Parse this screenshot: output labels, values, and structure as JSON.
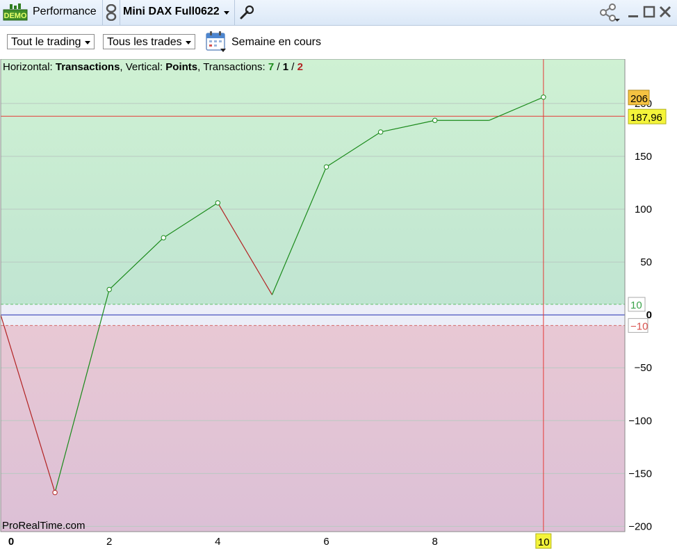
{
  "window": {
    "demo_badge": "DEMO",
    "title": "Performance",
    "instrument": "Mini DAX Full0622"
  },
  "toolbar": {
    "scope_dropdown": "Tout le trading",
    "trades_dropdown": "Tous les trades",
    "period_label": "Semaine en cours"
  },
  "header": {
    "prefix_horizontal": "Horizontal: ",
    "horizontal_value": "Transactions",
    "prefix_vertical": ", Vertical: ",
    "vertical_value": "Points",
    "prefix_transactions": ", Transactions: ",
    "count_winning": "7",
    "separator_1": " / ",
    "count_neutral": "1",
    "separator_2": " / ",
    "count_losing": "2"
  },
  "watermark": "ProRealTime.com",
  "colors": {
    "gain": "#1a8a1a",
    "loss": "#b22222",
    "positive_zone": "#cdf0d3",
    "negative_zone": "#e4c7d4",
    "zero_line": "#1f2bb0",
    "cursor": "#e53935",
    "last_value_badge": "#f5c242",
    "cursor_value_badge": "#f4f43a"
  },
  "chart_data": {
    "type": "line",
    "x": [
      0,
      1,
      2,
      3,
      4,
      5,
      6,
      7,
      8,
      9,
      10
    ],
    "y": [
      0,
      -168,
      24,
      73,
      106,
      19,
      140,
      173,
      184,
      184,
      206
    ],
    "markers": [
      1,
      2,
      3,
      4,
      6,
      7,
      8,
      10
    ],
    "xlim": [
      0,
      11.5
    ],
    "ylim": [
      -205,
      242
    ],
    "y_ticks": [
      -200,
      -150,
      -100,
      -50,
      0,
      50,
      100,
      150,
      200
    ],
    "x_ticks": [
      0,
      2,
      4,
      6,
      8,
      10
    ],
    "threshold_upper": 10,
    "threshold_lower": -10,
    "threshold_upper_label": "10",
    "threshold_lower_label": "-10",
    "cursor_x": 10,
    "cursor_x_label": "10",
    "cursor_y": 187.96,
    "cursor_y_label": "187,96",
    "last_value_label": "206",
    "grid": true
  }
}
